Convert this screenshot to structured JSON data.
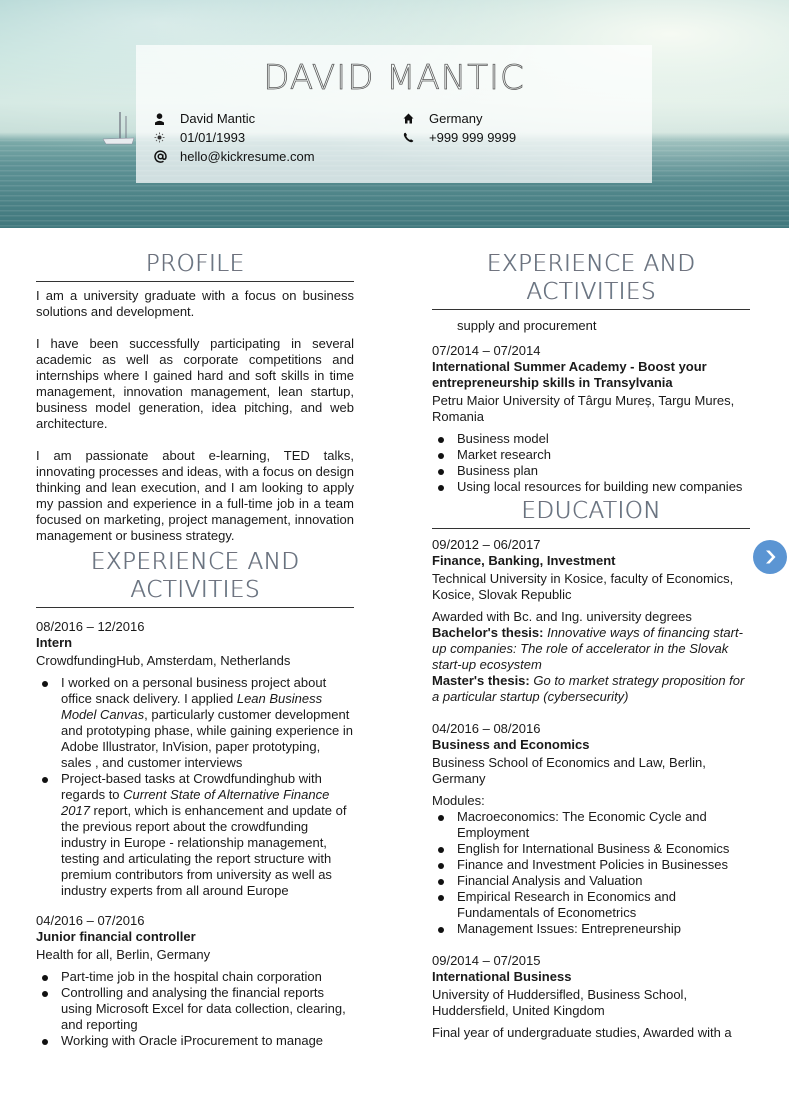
{
  "header": {
    "name": "DAVID MANTIC",
    "contacts": {
      "full_name": {
        "icon": "user-icon",
        "value": "David Mantic"
      },
      "birthdate": {
        "icon": "sun-icon",
        "value": "01/01/1993"
      },
      "email": {
        "icon": "at-icon",
        "value": "hello@kickresume.com"
      },
      "location": {
        "icon": "home-icon",
        "value": "Germany"
      },
      "phone": {
        "icon": "phone-icon",
        "value": "+999 999 9999"
      }
    }
  },
  "profile": {
    "title": "PROFILE",
    "paragraphs": [
      "I am a university graduate with a focus on business solutions and development.",
      "I have been successfully participating in several academic as well as corporate competitions and internships where I gained hard and soft skills in time management, innovation management, lean startup, business model generation, idea pitching, and web architecture.",
      "I am passionate about e-learning, TED talks, innovating processes and ideas, with a focus on design thinking and lean execution, and I am looking to apply my passion and experience in a full-time job in a team focused on marketing, project management, innovation management or business strategy."
    ]
  },
  "experience": {
    "title": "EXPERIENCE AND ACTIVITIES",
    "entries": [
      {
        "date": "08/2016 – 12/2016",
        "title": "Intern",
        "org": "CrowdfundingHub, Amsterdam, Netherlands",
        "bullets": [
          {
            "pre": "I worked on a personal business project about office snack delivery. I applied ",
            "em": "Lean Business Model Canvas",
            "post": ", particularly customer development and prototyping phase, while gaining experience in Adobe Illustrator, InVision, paper prototyping, sales , and customer interviews"
          },
          {
            "pre": "Project-based tasks at Crowdfundinghub with regards to ",
            "em": "Current State of Alternative Finance 2017",
            "post": " report, which is enhancement and update of the previous report about the crowdfunding industry in Europe - relationship management, testing and articulating the report structure with premium contributors from university as well as industry experts from all around Europe"
          }
        ]
      },
      {
        "date": "04/2016 – 07/2016",
        "title": "Junior financial controller",
        "org": "Health for all, Berlin, Germany",
        "bullets": [
          "Part-time job in the hospital chain corporation",
          "Controlling and analysing the financial reports using Microsoft Excel for data collection, clearing, and reporting",
          "Working with Oracle iProcurement to manage"
        ],
        "continued": "supply and procurement"
      },
      {
        "date": "07/2014 – 07/2014",
        "title": "International Summer Academy - Boost your entrepreneurship skills in Transylvania",
        "org": "Petru Maior University of Târgu Mureș, Targu Mures, Romania",
        "bullets": [
          "Business model",
          "Market research",
          "Business plan",
          "Using local resources for building new companies"
        ]
      }
    ]
  },
  "education": {
    "title": "EDUCATION",
    "entries": [
      {
        "date": "09/2012 – 06/2017",
        "title": "Finance, Banking, Investment",
        "org": "Technical University in Kosice, faculty of Economics, Kosice, Slovak Republic",
        "desc": "Awarded with Bc. and Ing. university degrees",
        "bachelor_label": "Bachelor's thesis:",
        "bachelor_text": " Innovative ways of financing start-up companies: The role of accelerator in the Slovak start-up ecosystem",
        "master_label": "Master's thesis:",
        "master_text": " Go to market strategy proposition for a particular startup (cybersecurity)"
      },
      {
        "date": "04/2016 – 08/2016",
        "title": "Business and Economics",
        "org": "Business School of Economics and Law, Berlin, Germany",
        "desc": "Modules:",
        "bullets": [
          "Macroeconomics: The Economic Cycle and Employment",
          "English for International Business & Economics",
          "Finance and Investment Policies in Businesses",
          "Financial Analysis and Valuation",
          "Empirical Research in Economics and Fundamentals of Econometrics",
          "Management Issues: Entrepreneurship"
        ]
      },
      {
        "date": "09/2014 – 07/2015",
        "title": "International Business",
        "org": "University of Huddersifled, Business School, Huddersfield, United Kingdom",
        "desc": "Final year of undergraduate studies, Awarded with a"
      }
    ]
  },
  "nav": {
    "next_icon": "chevron-right-circle-icon",
    "accent": "#5b95d3"
  }
}
